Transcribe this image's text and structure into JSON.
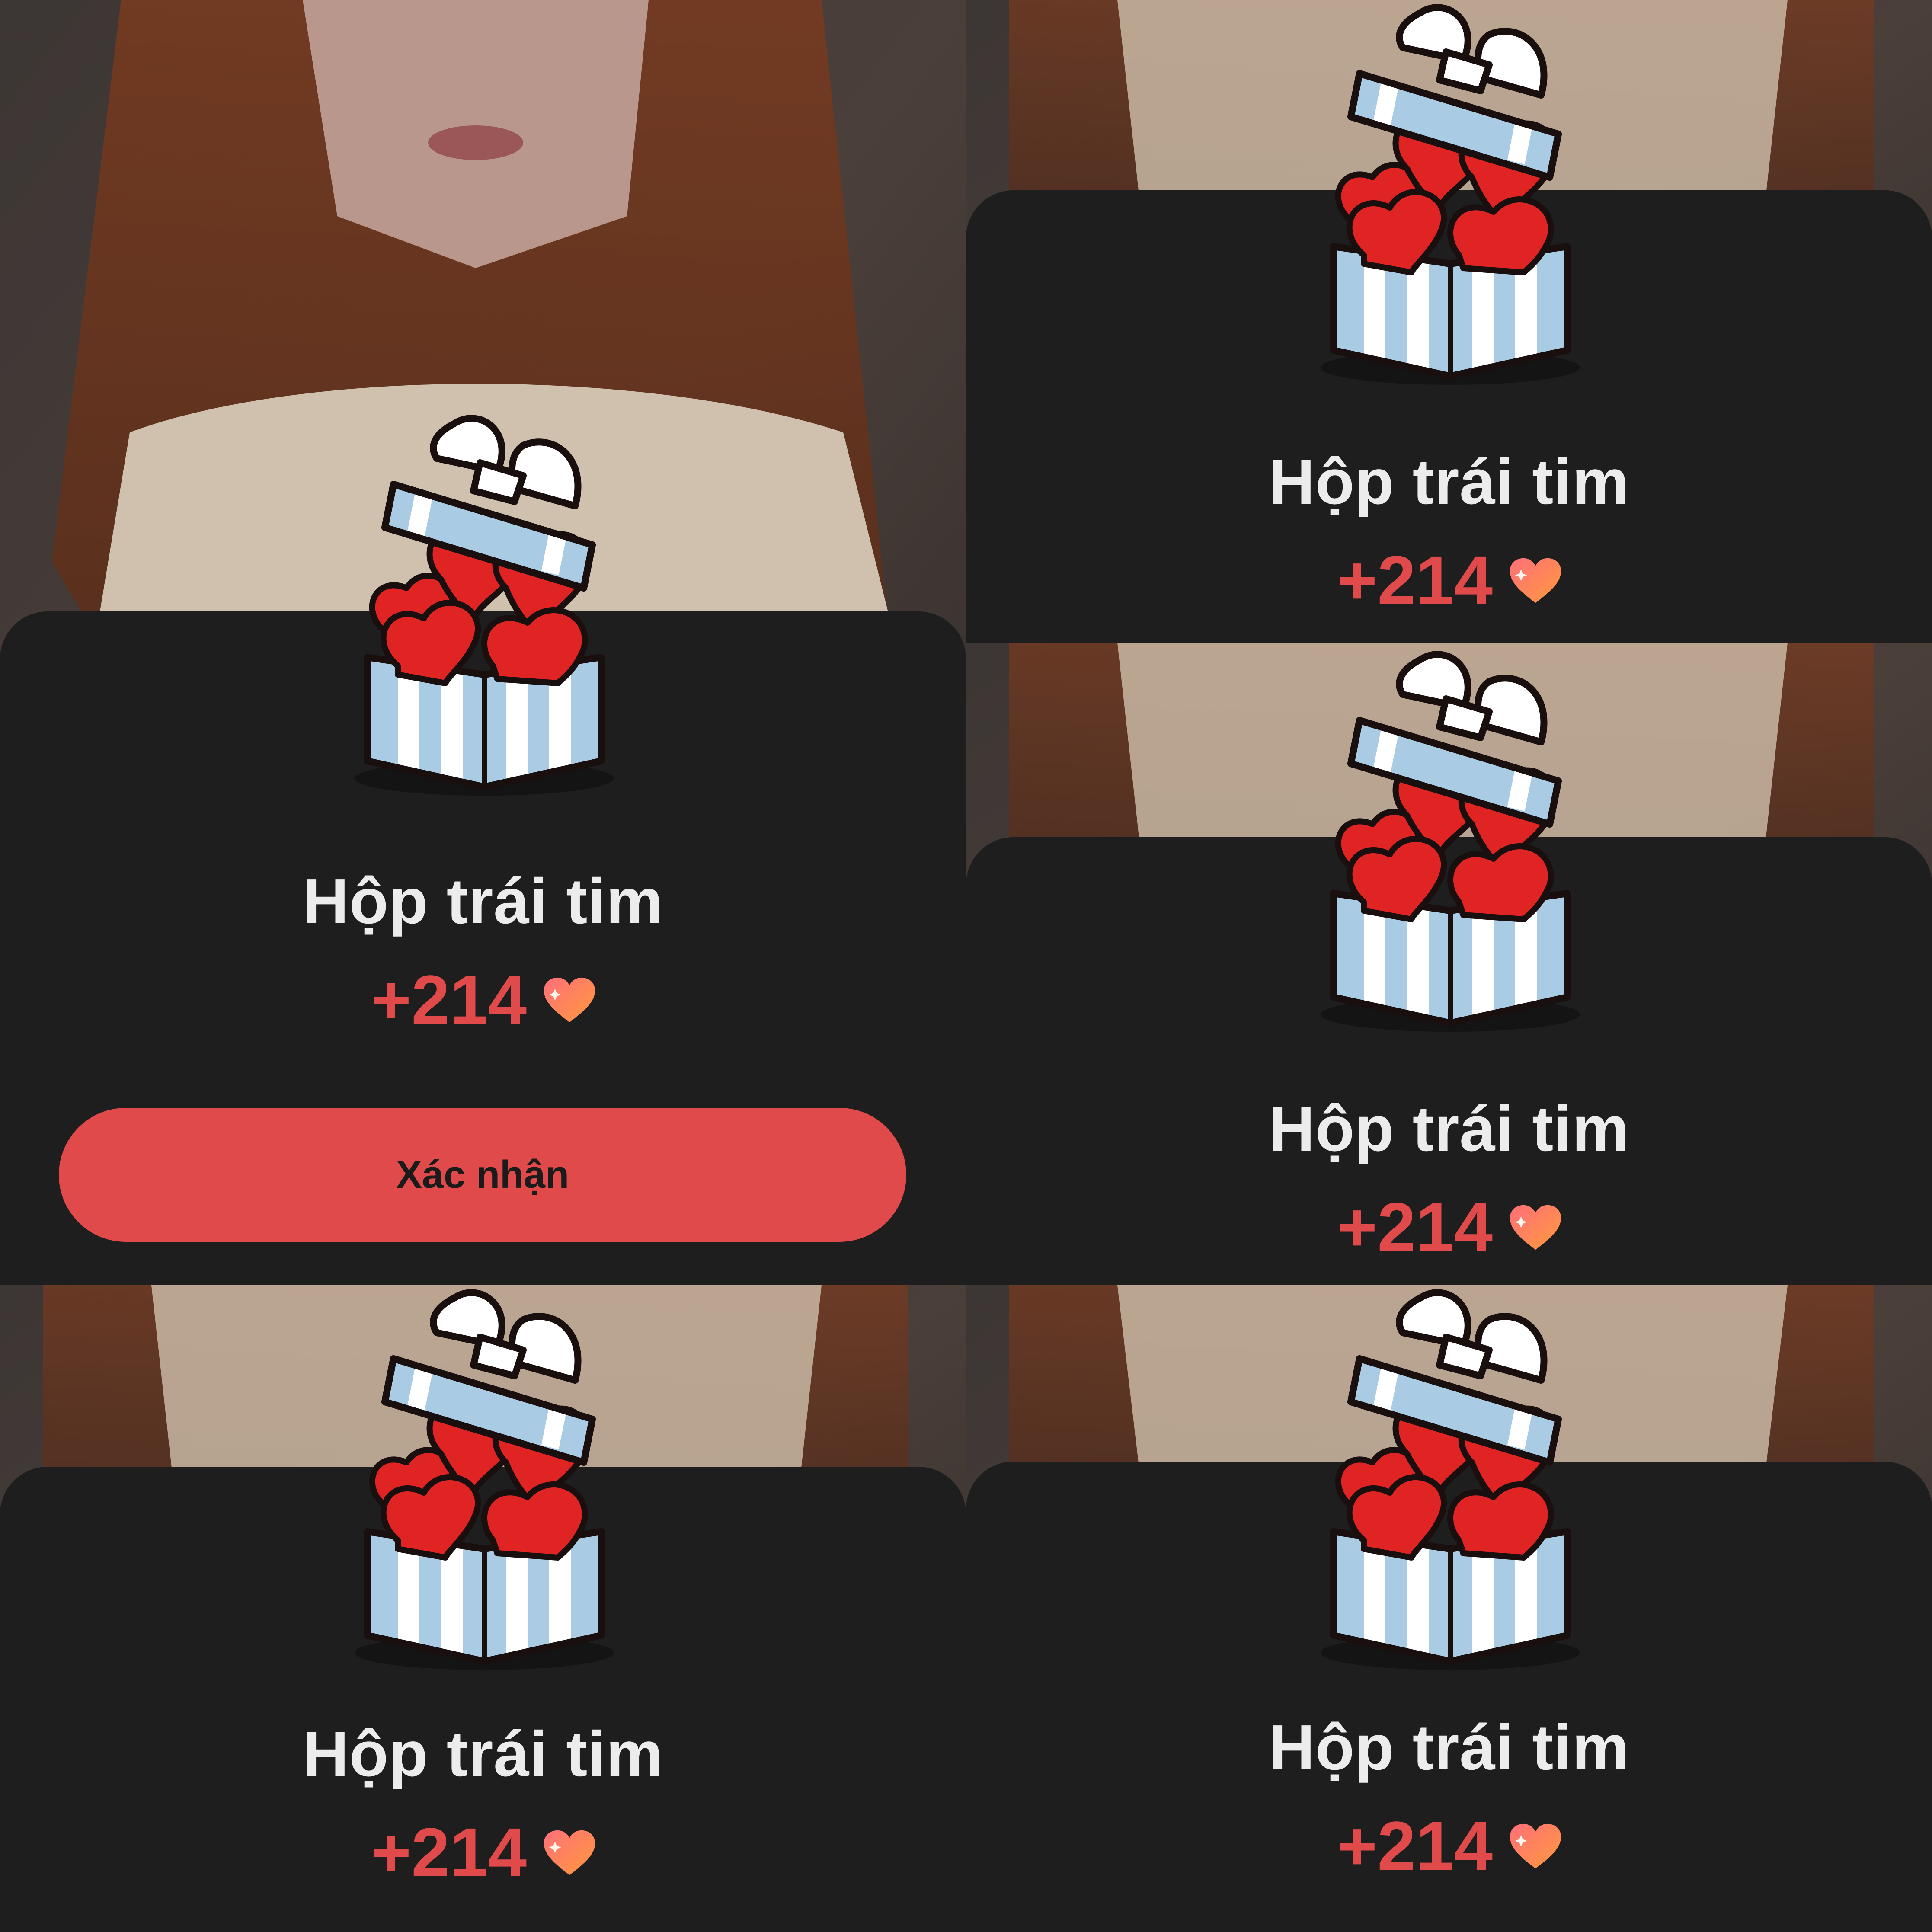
{
  "modal": {
    "title": "Hộp trái tim",
    "amount": "+214",
    "reward_icon": "heart-icon",
    "gift_icon": "gift-box-hearts-icon",
    "confirm_label": "Xác nhận"
  },
  "colors": {
    "sheet": "#1e1e1f",
    "accent": "#e04a4a",
    "title": "#ececec"
  }
}
